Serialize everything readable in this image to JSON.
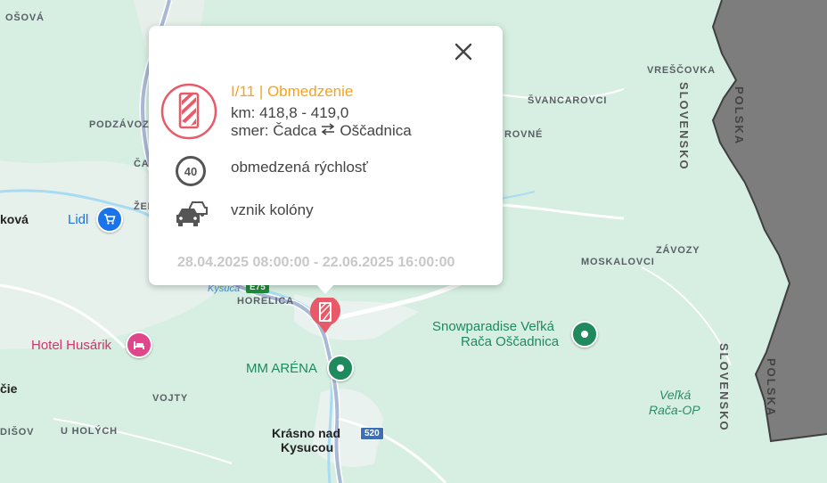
{
  "map": {
    "places": {
      "sosova": "OŠOVÁ",
      "podzavoz": "PODZÁVOZ",
      "cad": "ČAD",
      "zel": "ŽEL",
      "kova": "ková",
      "vrescovka": "VREŠČOVKA",
      "svancarovci": "ŠVANCAROVCI",
      "rovne": "ROVNÉ",
      "moskalovci": "MOSKALOVCI",
      "zavozy": "ZÁVOZY",
      "horelica": "HORELICA",
      "vojty": "VOJTY",
      "uholych": "U HOLÝCH",
      "disov": "DIŠOV",
      "cie": "čie",
      "krasno_line1": "Krásno nad",
      "krasno_line2": "Kysucou",
      "kysuca": "Kysuca"
    },
    "borders": {
      "slovensko": "SLOVENSKO",
      "polska": "POLSKA"
    },
    "pois": {
      "lidl": "Lidl",
      "hotel": "Hotel Husárik",
      "mm_arena": "MM ARÉNA",
      "snowparadise_line1": "Snowparadise Veľká",
      "snowparadise_line2": "Rača Oščadnica",
      "velka_raca_line1": "Veľká",
      "velka_raca_line2": "Rača-OP"
    },
    "road_shields": {
      "r520": "520",
      "e75": "E75"
    },
    "colors": {
      "land": "#d7efe2",
      "poland": "#7d7d7d",
      "road": "#a9b8d4",
      "accent_orange": "#f7a21b",
      "warning_red": "#e85a67"
    }
  },
  "popup": {
    "title": "I/11 | Obmedzenie",
    "km": "km: 418,8 - 419,0",
    "direction_prefix": "smer: Čadca",
    "direction_suffix": "Oščadnica",
    "speed_sign": "40",
    "speed_label": "obmedzená rýchlosť",
    "traffic_label": "vznik kolóny",
    "date_range": "28.04.2025 08:00:00 - 22.06.2025 16:00:00"
  }
}
